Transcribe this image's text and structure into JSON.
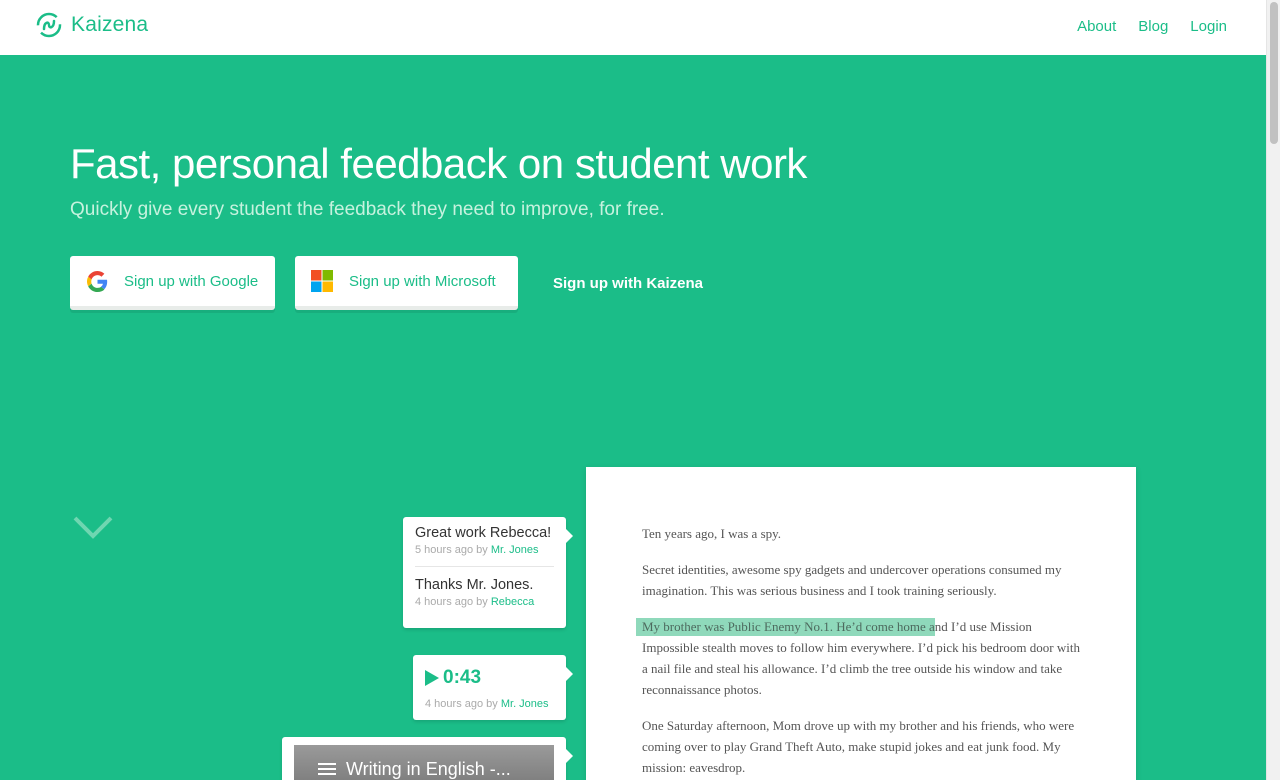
{
  "header": {
    "brand": "Kaizena",
    "nav": [
      {
        "label": "About"
      },
      {
        "label": "Blog"
      },
      {
        "label": "Login"
      }
    ]
  },
  "hero": {
    "title": "Fast, personal feedback on student work",
    "subtitle": "Quickly give every student the feedback they need to improve, for free.",
    "buttons": {
      "google": "Sign up with Google",
      "microsoft": "Sign up with Microsoft",
      "kaizena": "Sign up with Kaizena"
    }
  },
  "comments": [
    {
      "text": "Great work Rebecca!",
      "time": "5 hours ago by",
      "author": "Mr. Jones"
    },
    {
      "text": "Thanks Mr. Jones.",
      "time": "4 hours ago by",
      "author": "Rebecca"
    }
  ],
  "audio": {
    "duration": "0:43",
    "time": "4 hours ago by",
    "author": "Mr. Jones"
  },
  "video": {
    "title": "Writing in English -..."
  },
  "document": {
    "p1": "Ten years ago, I was a spy.",
    "p2": "Secret identities, awesome spy gadgets and undercover operations consumed my imagination. This was serious business and I took training seriously.",
    "p3_highlight": "My brother was Public Enemy No.1. He’d come home a",
    "p3_rest": "nd I’d use Mission Impossible stealth moves to follow him everywhere. I’d pick his bedroom door with a nail file and steal his allowance. I’d climb the tree outside his window and take reconnaissance photos.",
    "p4": "One Saturday afternoon, Mom drove up with my brother and his friends, who were coming over to play Grand Theft Auto, make stupid jokes and eat junk food. My mission: eavesdrop."
  },
  "colors": {
    "brand": "#1bbd88",
    "highlight": "#8fd9bb",
    "white": "#ffffff"
  },
  "icons": [
    "kaizena-logo-icon",
    "google-icon",
    "microsoft-icon",
    "chevron-down-icon",
    "play-icon",
    "playlist-icon"
  ]
}
